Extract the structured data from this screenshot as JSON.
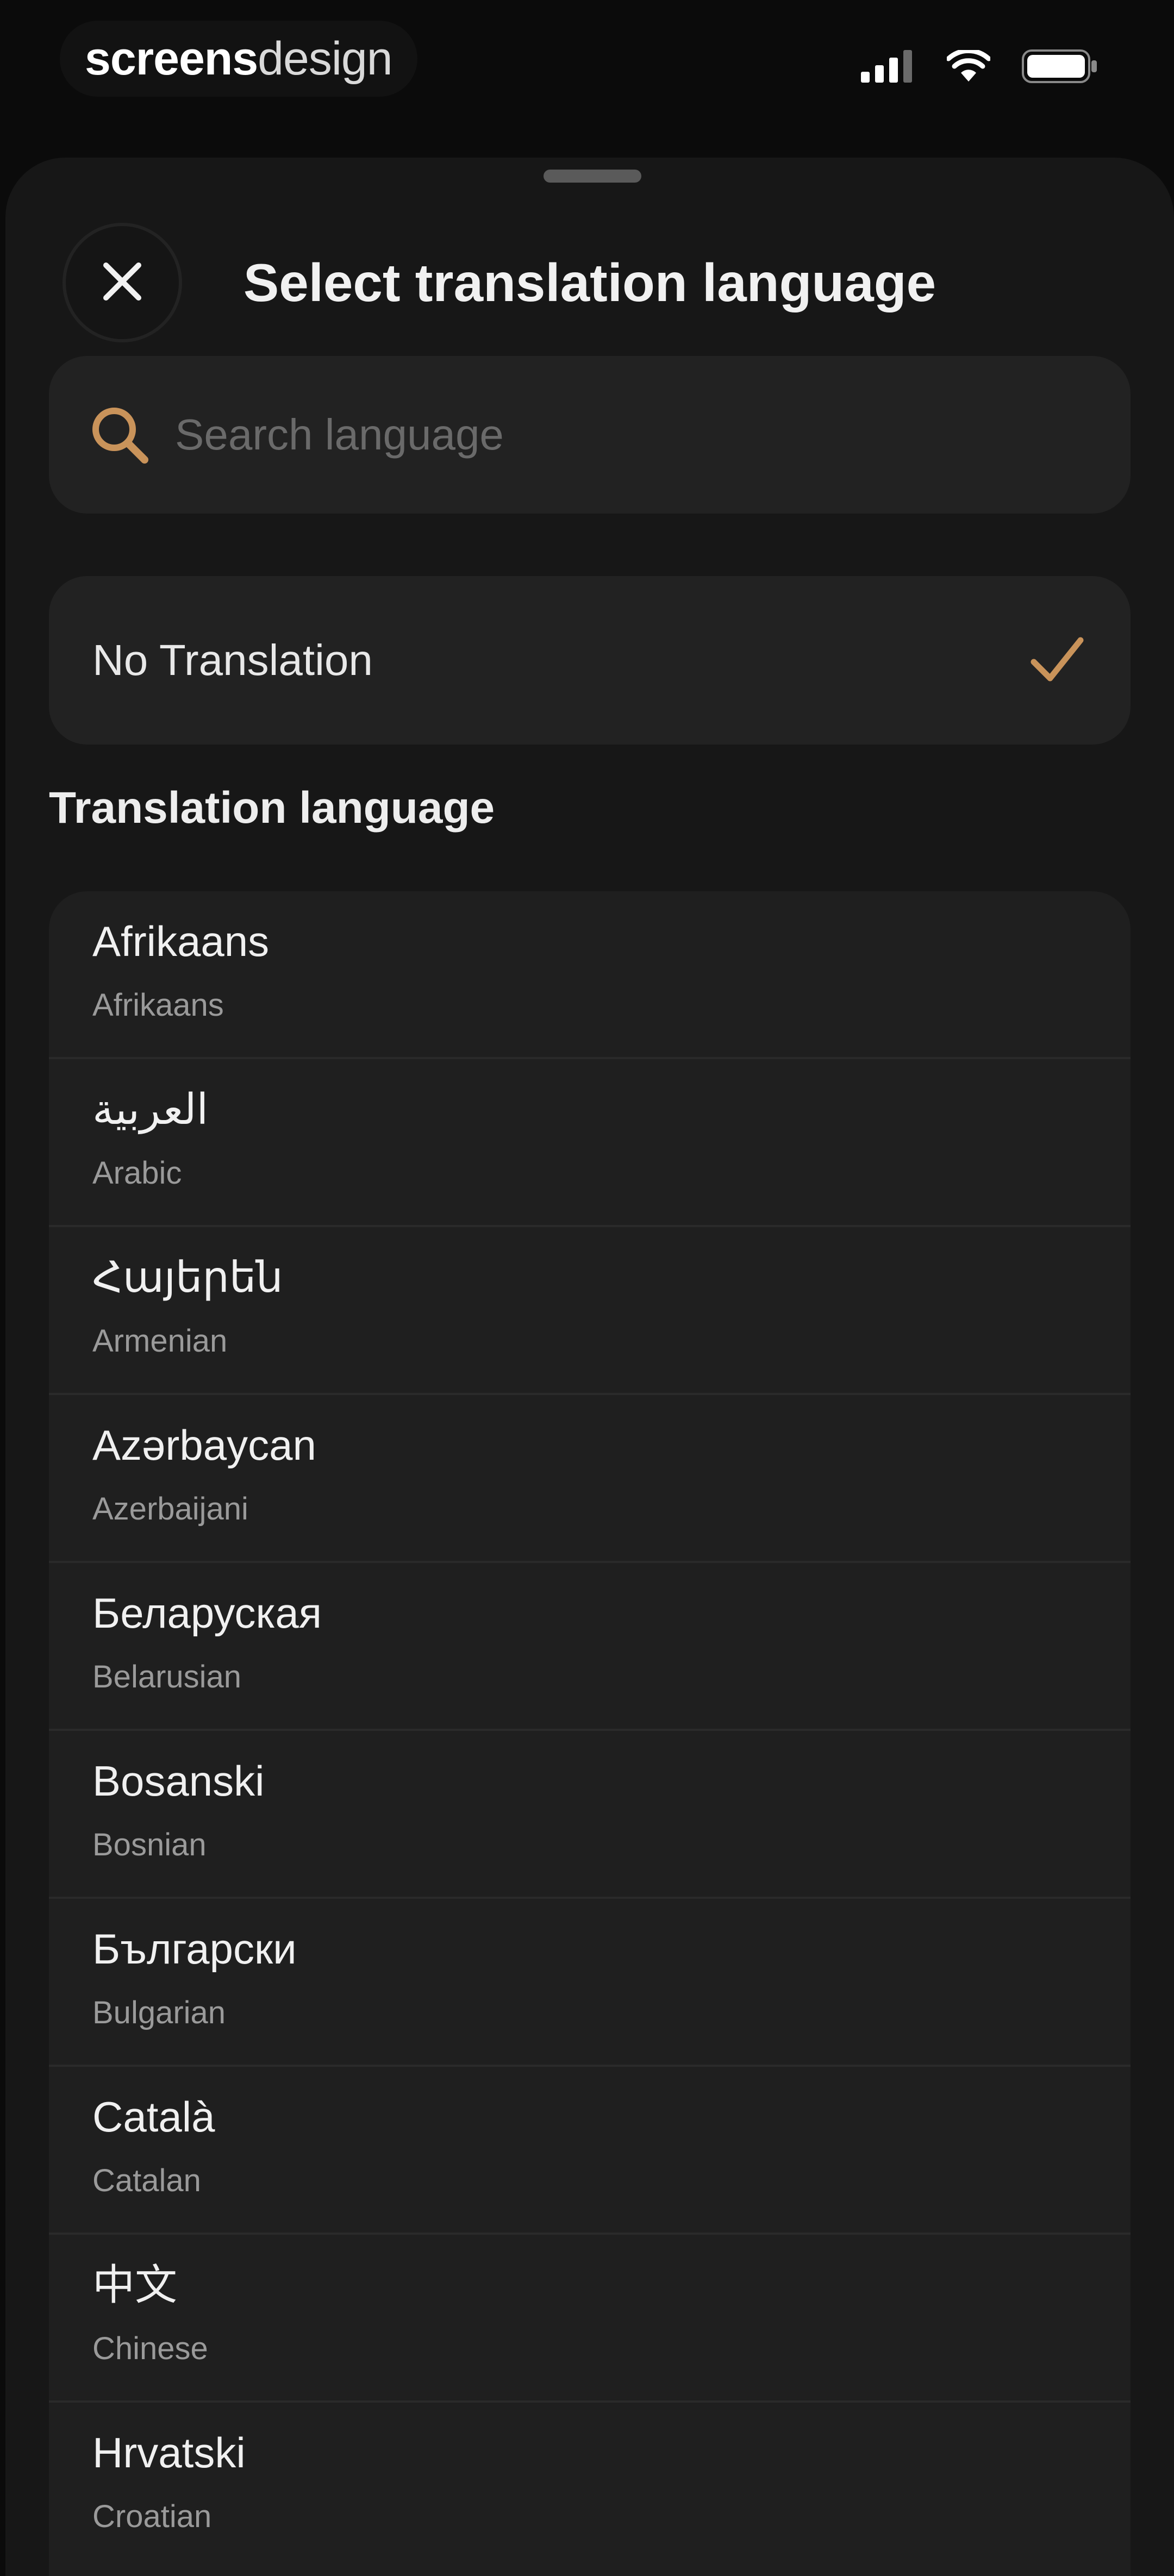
{
  "status_bar": {
    "brand_bold": "screens",
    "brand_light": "design"
  },
  "sheet": {
    "title": "Select translation language",
    "close_icon": "close-icon"
  },
  "search": {
    "placeholder": "Search language",
    "value": "",
    "icon": "search-icon",
    "accent_color": "#c9935a"
  },
  "no_translation": {
    "label": "No Translation",
    "selected": true,
    "check_color": "#c9935a"
  },
  "section_header": "Translation language",
  "languages": [
    {
      "native": "Afrikaans",
      "english": "Afrikaans"
    },
    {
      "native": "العربية",
      "english": "Arabic"
    },
    {
      "native": "Հայերեն",
      "english": "Armenian"
    },
    {
      "native": "Azərbaycan",
      "english": "Azerbaijani"
    },
    {
      "native": "Беларуская",
      "english": "Belarusian"
    },
    {
      "native": "Bosanski",
      "english": "Bosnian"
    },
    {
      "native": "Български",
      "english": "Bulgarian"
    },
    {
      "native": "Català",
      "english": "Catalan"
    },
    {
      "native": "中文",
      "english": "Chinese"
    },
    {
      "native": "Hrvatski",
      "english": "Croatian"
    }
  ]
}
